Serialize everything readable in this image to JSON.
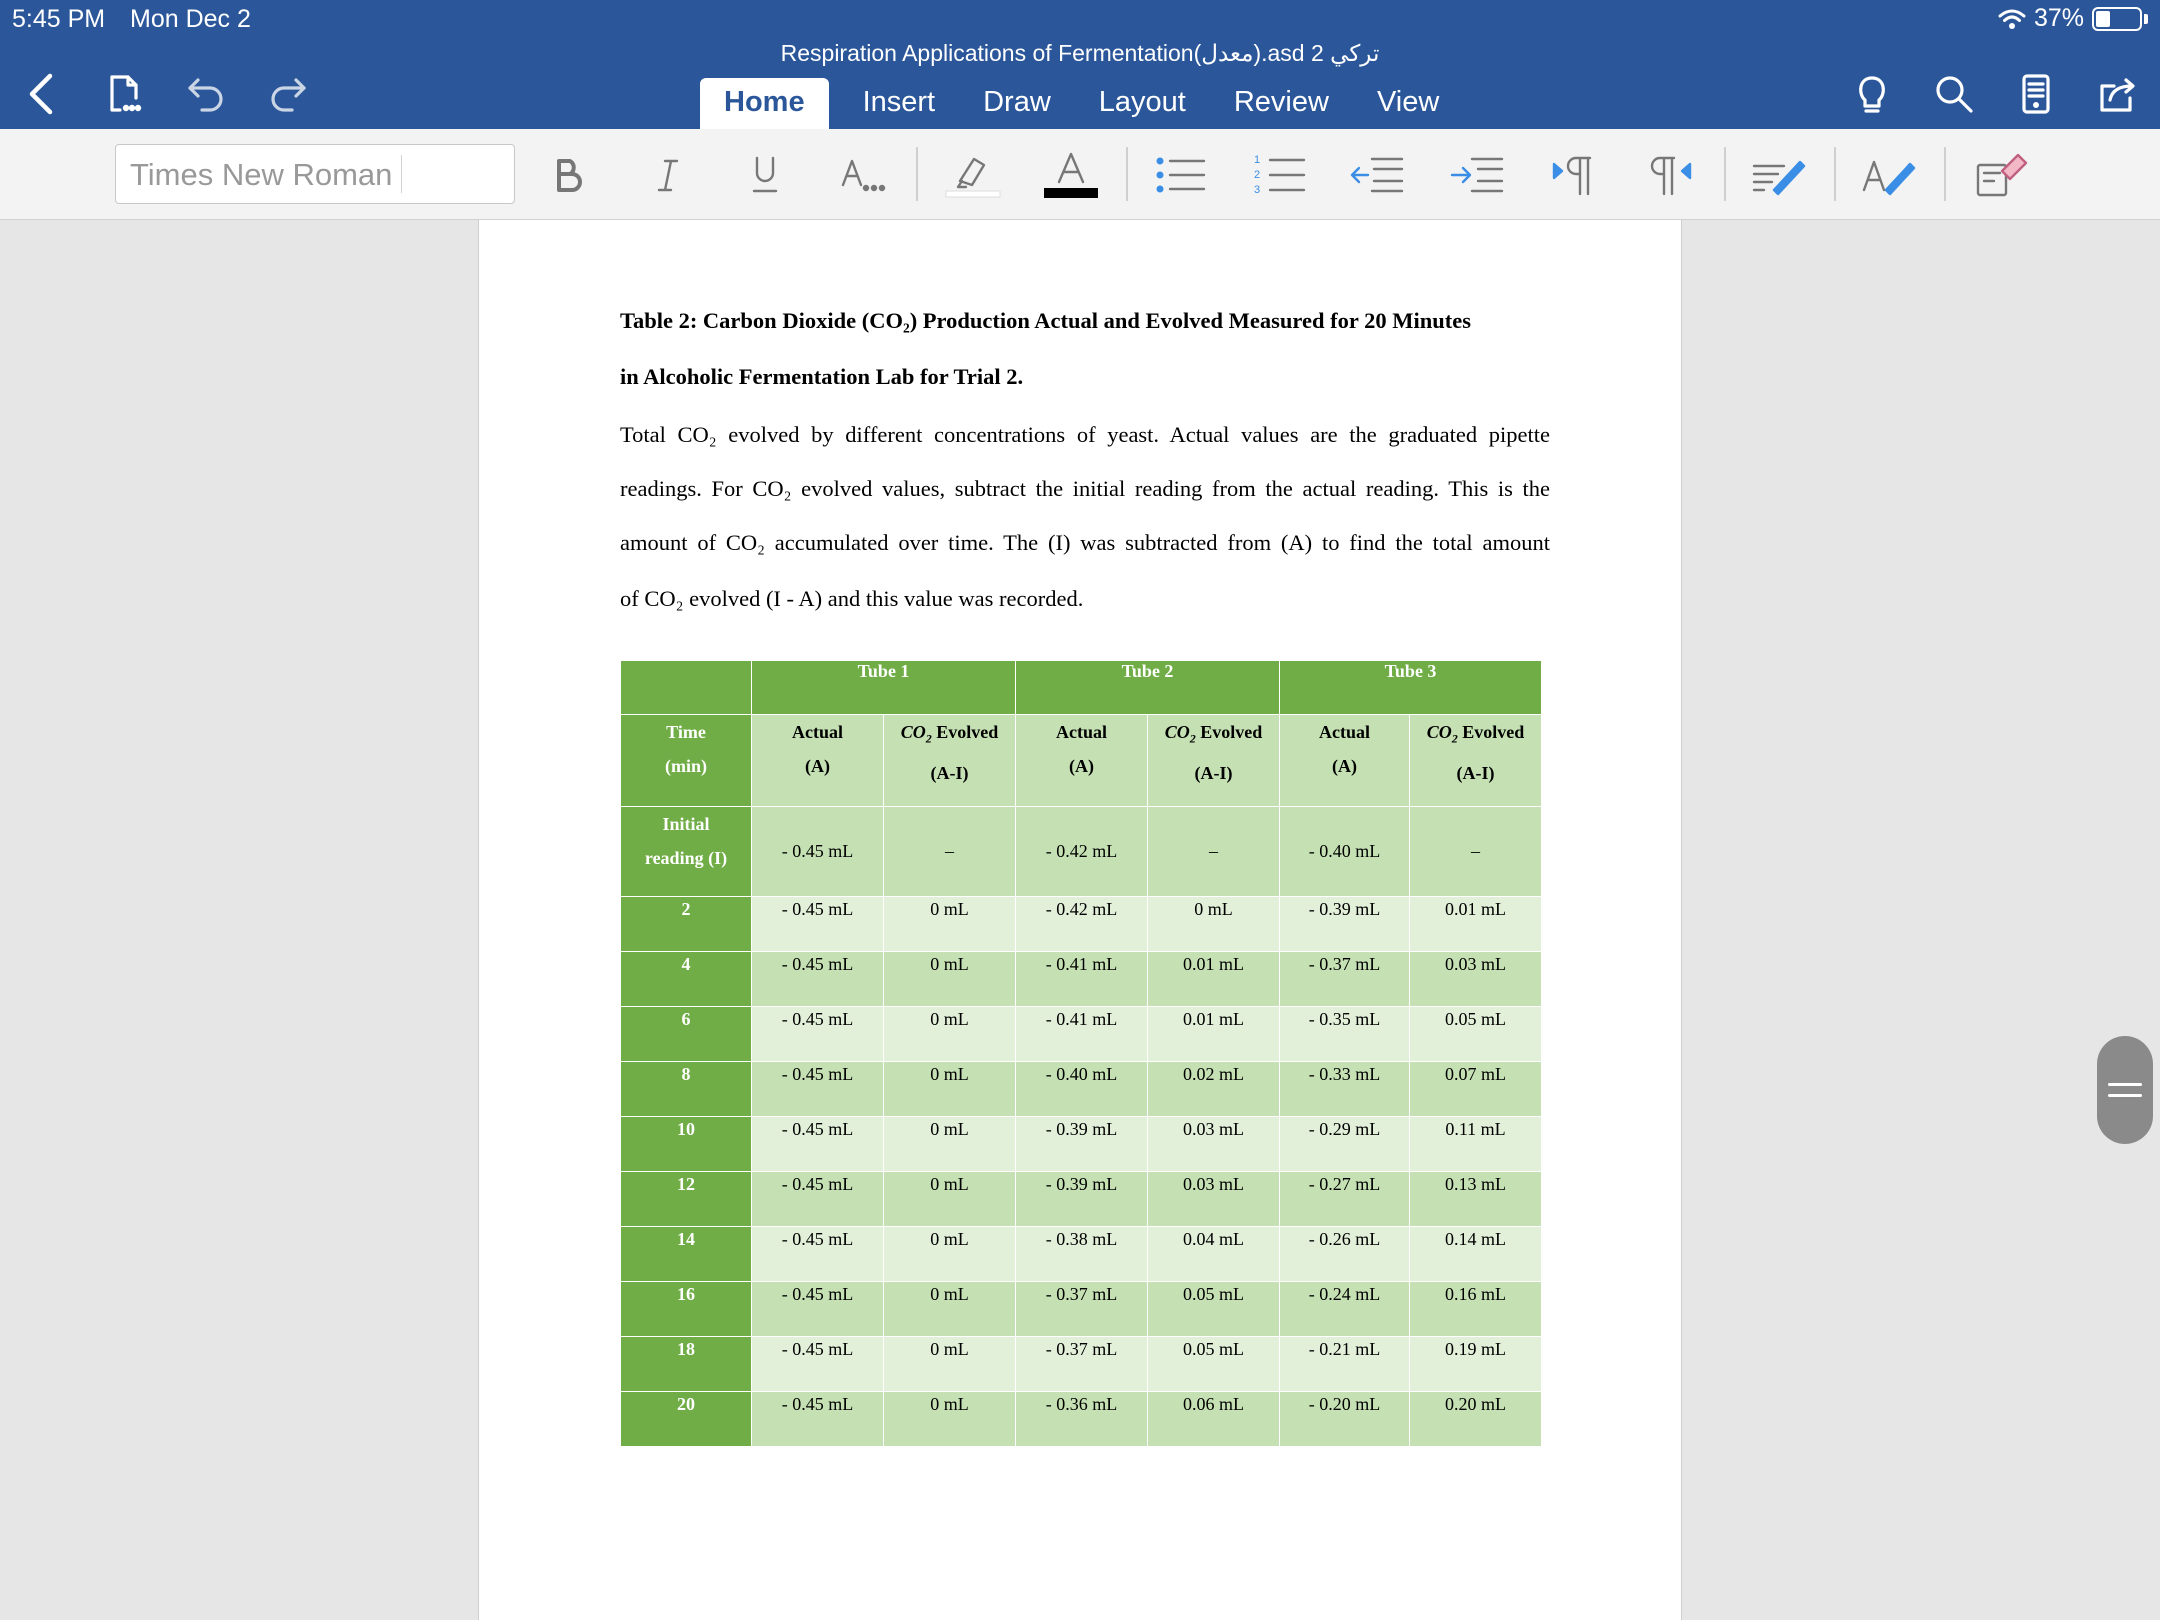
{
  "status": {
    "time": "5:45 PM",
    "date": "Mon Dec 2",
    "battery": "37%"
  },
  "document": {
    "title": "Respiration Applications of Fermentation(معدل).asd 2 تركي"
  },
  "tabs": [
    "Home",
    "Insert",
    "Draw",
    "Layout",
    "Review",
    "View"
  ],
  "ribbon": {
    "font_name": "Times New Roman",
    "font_size": ""
  },
  "icons": [
    "back-icon",
    "file-icon",
    "undo-icon",
    "redo-icon",
    "lightbulb-icon",
    "search-icon",
    "reading-mode-icon",
    "share-icon",
    "bold-icon",
    "italic-icon",
    "underline-icon",
    "text-effects-icon",
    "highlighter-icon",
    "font-color-icon",
    "bullets-icon",
    "numbering-icon",
    "decrease-indent-icon",
    "increase-indent-icon",
    "ltr-paragraph-icon",
    "rtl-paragraph-icon",
    "styles-icon",
    "text-styles-icon",
    "clear-formatting-icon"
  ],
  "colors": {
    "topbar": "#2b579a",
    "table_header": "#70ad47",
    "table_band_dark": "#c5e0b3",
    "table_band_light": "#e2efd9"
  },
  "page": {
    "caption_line1": "Table 2: Carbon Dioxide (CO₂) Production Actual and Evolved Measured for 20 Minutes",
    "caption_line2": "in Alcoholic Fermentation Lab for Trial 2.",
    "para_lines": [
      "Total CO₂ evolved by different concentrations of yeast. Actual values are the graduated pipette",
      "readings. For CO₂ evolved values, subtract the initial reading from the actual reading. This is the",
      "amount of CO₂ accumulated over time. The (I) was subtracted from (A) to find the total amount",
      "of CO₂ evolved (I - A) and this value was recorded."
    ]
  },
  "table": {
    "groups": [
      "Tube 1",
      "Tube 2",
      "Tube 3"
    ],
    "time_header": [
      "Time",
      "(min)"
    ],
    "actual_header": [
      "Actual",
      "(A)"
    ],
    "evolved_header": [
      "CO",
      "2",
      " Evolved",
      "(A-I)"
    ],
    "initial": {
      "label": [
        "Initial",
        "reading (I)"
      ],
      "values": [
        "- 0.45 mL",
        "–",
        "- 0.42 mL",
        "–",
        "- 0.40 mL",
        "–"
      ]
    },
    "rows": [
      {
        "time": "2",
        "values": [
          "- 0.45 mL",
          "0 mL",
          "- 0.42 mL",
          "0 mL",
          "- 0.39 mL",
          "0.01 mL"
        ]
      },
      {
        "time": "4",
        "values": [
          "- 0.45 mL",
          "0 mL",
          "- 0.41 mL",
          "0.01 mL",
          "- 0.37 mL",
          "0.03 mL"
        ]
      },
      {
        "time": "6",
        "values": [
          "- 0.45 mL",
          "0 mL",
          "- 0.41 mL",
          "0.01 mL",
          "- 0.35 mL",
          "0.05 mL"
        ]
      },
      {
        "time": "8",
        "values": [
          "- 0.45 mL",
          "0 mL",
          "- 0.40 mL",
          "0.02 mL",
          "- 0.33 mL",
          "0.07 mL"
        ]
      },
      {
        "time": "10",
        "values": [
          "- 0.45 mL",
          "0 mL",
          "- 0.39 mL",
          "0.03 mL",
          "- 0.29 mL",
          "0.11 mL"
        ]
      },
      {
        "time": "12",
        "values": [
          "- 0.45 mL",
          "0 mL",
          "- 0.39 mL",
          "0.03 mL",
          "- 0.27 mL",
          "0.13 mL"
        ]
      },
      {
        "time": "14",
        "values": [
          "- 0.45 mL",
          "0 mL",
          "- 0.38 mL",
          "0.04 mL",
          "- 0.26 mL",
          "0.14 mL"
        ]
      },
      {
        "time": "16",
        "values": [
          "- 0.45 mL",
          "0 mL",
          "- 0.37 mL",
          "0.05 mL",
          "- 0.24 mL",
          "0.16 mL"
        ]
      },
      {
        "time": "18",
        "values": [
          "- 0.45 mL",
          "0 mL",
          "- 0.37 mL",
          "0.05 mL",
          "- 0.21 mL",
          "0.19 mL"
        ]
      },
      {
        "time": "20",
        "values": [
          "- 0.45 mL",
          "0 mL",
          "- 0.36 mL",
          "0.06 mL",
          "- 0.20 mL",
          "0.20 mL"
        ]
      }
    ]
  }
}
